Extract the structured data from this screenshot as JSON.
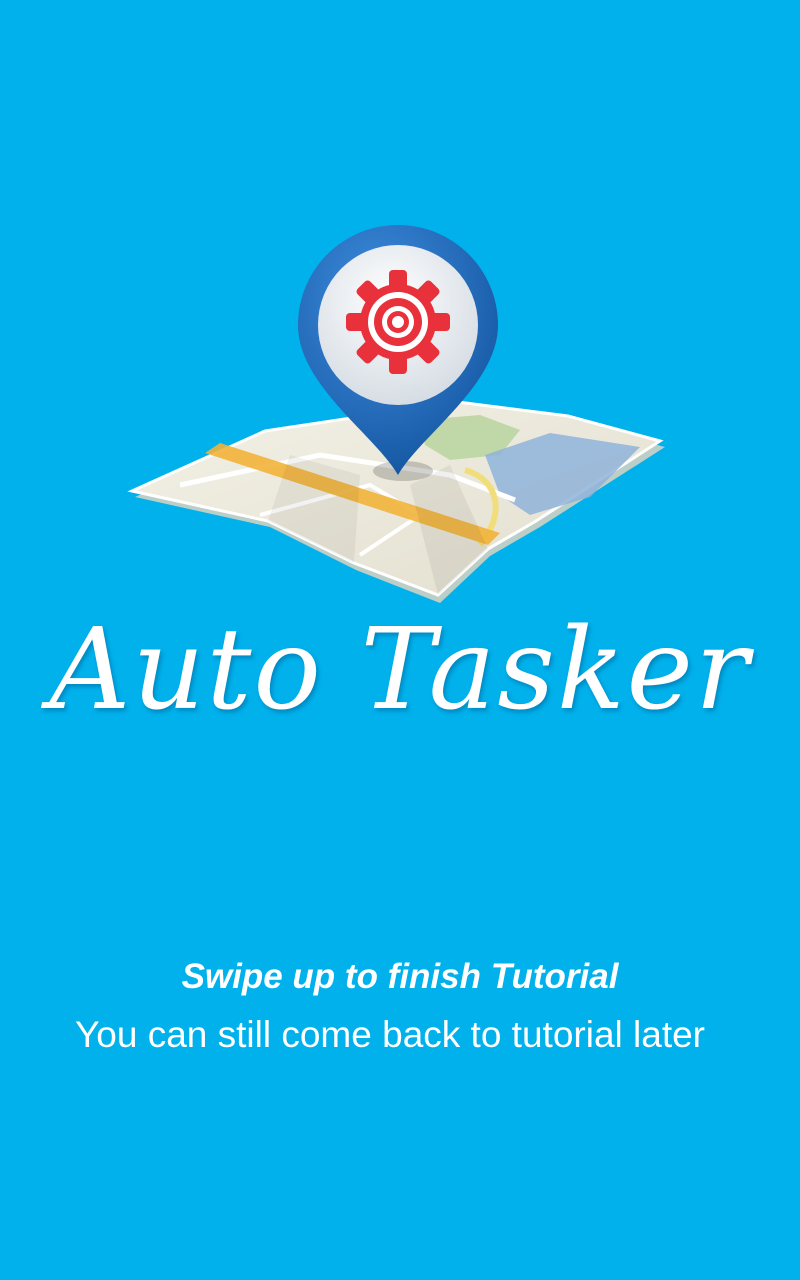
{
  "app": {
    "title": "Auto Tasker",
    "logo_icon": "map-pin-gear-icon"
  },
  "tutorial": {
    "primary_hint": "Swipe up to finish Tutorial",
    "secondary_hint": "You can still come back to tutorial later"
  },
  "colors": {
    "background": "#00b1ec",
    "pin_blue": "#1f6fc1",
    "gear_red": "#e8313a",
    "text": "#ffffff"
  }
}
